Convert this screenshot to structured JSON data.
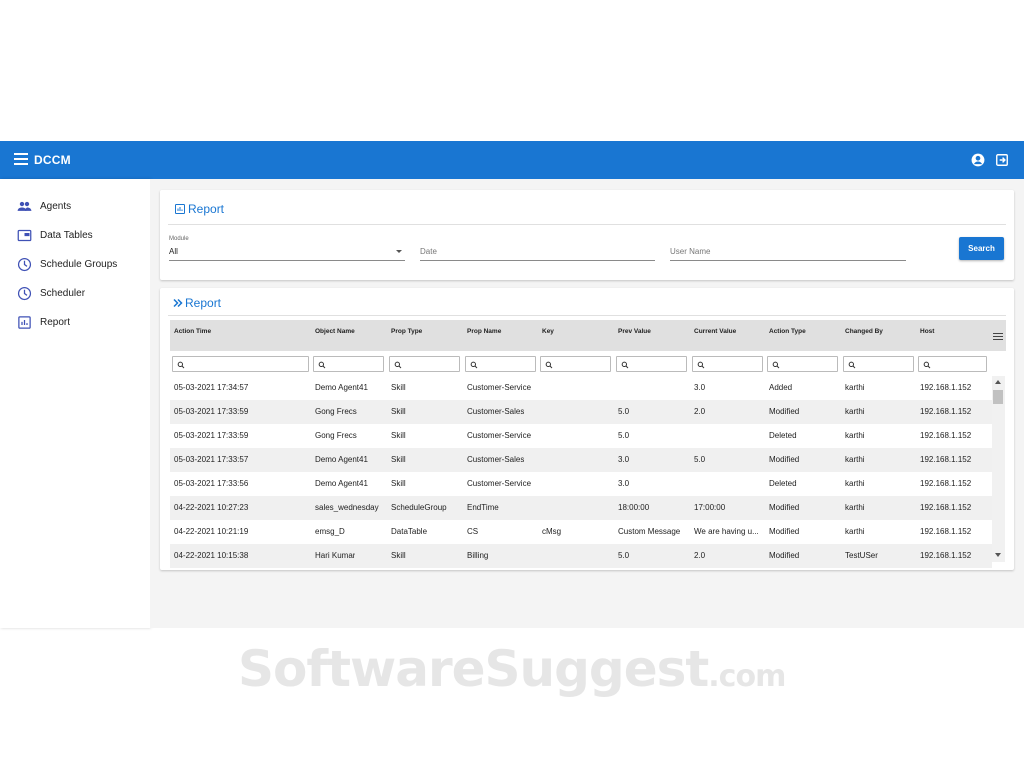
{
  "app": {
    "title": "DCCM"
  },
  "sidebar": {
    "items": [
      {
        "label": "Agents",
        "icon": "people-icon"
      },
      {
        "label": "Data Tables",
        "icon": "folder-icon"
      },
      {
        "label": "Schedule Groups",
        "icon": "clock-icon"
      },
      {
        "label": "Scheduler",
        "icon": "clock-icon"
      },
      {
        "label": "Report",
        "icon": "chart-icon"
      }
    ]
  },
  "filter_card": {
    "title": "Report",
    "module_label": "Module",
    "module_value": "All",
    "date_placeholder": "Date",
    "username_placeholder": "User Name",
    "search_label": "Search"
  },
  "results_card": {
    "title": "Report"
  },
  "table": {
    "columns": [
      "Action Time",
      "Object Name",
      "Prop Type",
      "Prop Name",
      "Key",
      "Prev Value",
      "Current Value",
      "Action Type",
      "Changed By",
      "Host"
    ],
    "rows": [
      [
        "05-03-2021 17:34:57",
        "Demo Agent41",
        "Skill",
        "Customer-Service",
        "",
        "",
        "3.0",
        "Added",
        "karthi",
        "192.168.1.152"
      ],
      [
        "05-03-2021 17:33:59",
        "Gong Frecs",
        "Skill",
        "Customer-Sales",
        "",
        "5.0",
        "2.0",
        "Modified",
        "karthi",
        "192.168.1.152"
      ],
      [
        "05-03-2021 17:33:59",
        "Gong Frecs",
        "Skill",
        "Customer-Service",
        "",
        "5.0",
        "",
        "Deleted",
        "karthi",
        "192.168.1.152"
      ],
      [
        "05-03-2021 17:33:57",
        "Demo Agent41",
        "Skill",
        "Customer-Sales",
        "",
        "3.0",
        "5.0",
        "Modified",
        "karthi",
        "192.168.1.152"
      ],
      [
        "05-03-2021 17:33:56",
        "Demo Agent41",
        "Skill",
        "Customer-Service",
        "",
        "3.0",
        "",
        "Deleted",
        "karthi",
        "192.168.1.152"
      ],
      [
        "04-22-2021 10:27:23",
        "sales_wednesday",
        "ScheduleGroup",
        "EndTime",
        "",
        "18:00:00",
        "17:00:00",
        "Modified",
        "karthi",
        "192.168.1.152"
      ],
      [
        "04-22-2021 10:21:19",
        "emsg_D",
        "DataTable",
        "CS",
        "cMsg",
        "Custom Message",
        "We are having u...",
        "Modified",
        "karthi",
        "192.168.1.152"
      ],
      [
        "04-22-2021 10:15:38",
        "Hari Kumar",
        "Skill",
        "Billing",
        "",
        "5.0",
        "2.0",
        "Modified",
        "TestUSer",
        "192.168.1.152"
      ]
    ]
  },
  "watermark": {
    "main": "SoftwareSuggest",
    "suffix": ".com"
  },
  "colors": {
    "primary": "#1976d2",
    "header_bg": "#e0e0e0",
    "row_alt": "#f0f0f0"
  }
}
